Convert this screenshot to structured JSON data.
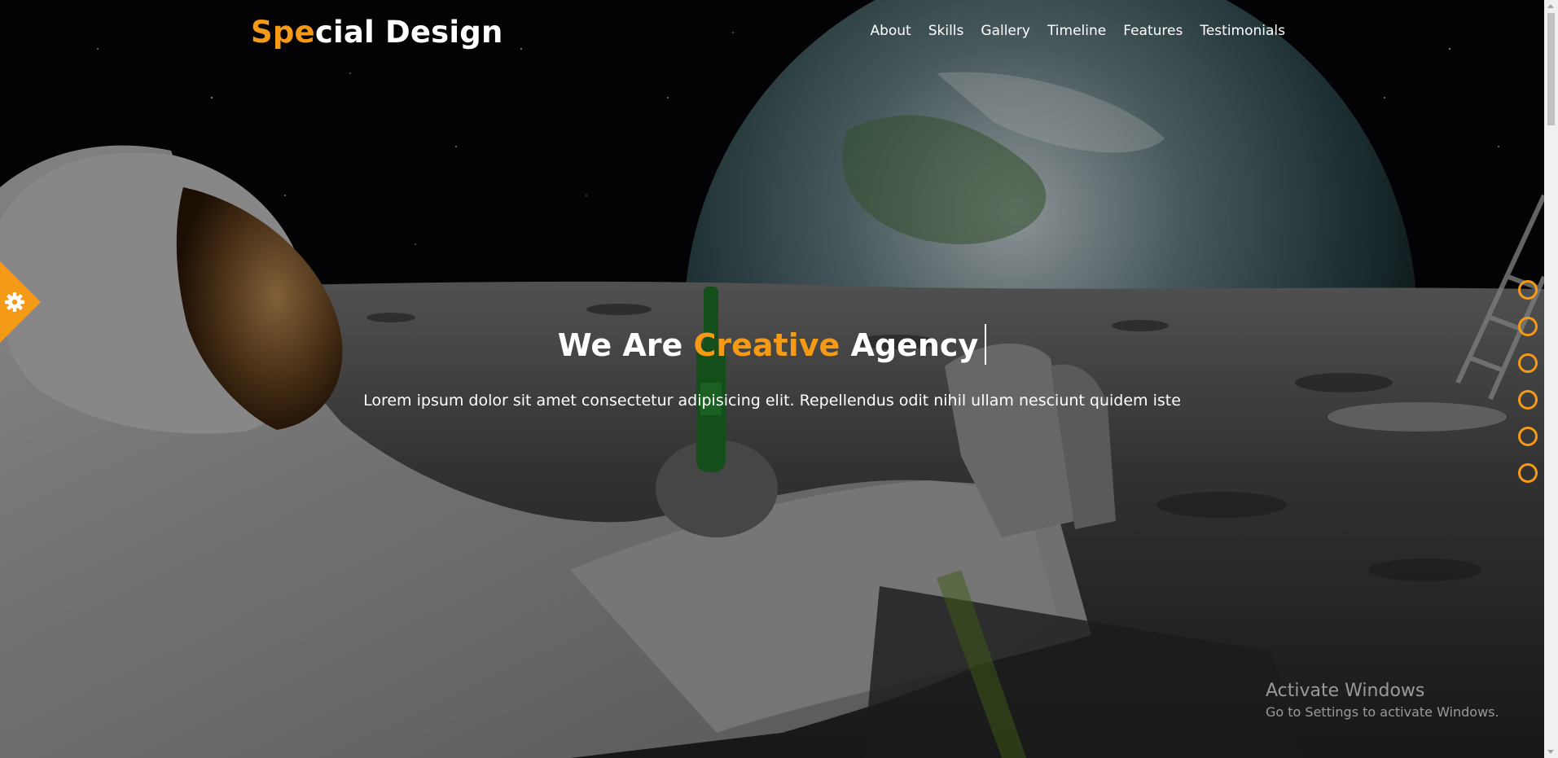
{
  "theme": {
    "accent": "#f59a16"
  },
  "header": {
    "logo_accent": "Spe",
    "logo_rest": "cial Design",
    "nav": [
      {
        "label": "About"
      },
      {
        "label": "Skills"
      },
      {
        "label": "Gallery"
      },
      {
        "label": "Timeline"
      },
      {
        "label": "Features"
      },
      {
        "label": "Testimonials"
      }
    ]
  },
  "hero": {
    "headline_pre": "We Are ",
    "headline_accent": "Creative",
    "headline_post": " Agency",
    "subtitle": "Lorem ipsum dolor sit amet consectetur adipisicing elit. Repellendus odit nihil ullam nesciunt quidem iste"
  },
  "settings": {
    "icon": "gear-icon"
  },
  "bullets": {
    "count": 6
  },
  "watermark": {
    "title": "Activate Windows",
    "subtitle": "Go to Settings to activate Windows."
  }
}
